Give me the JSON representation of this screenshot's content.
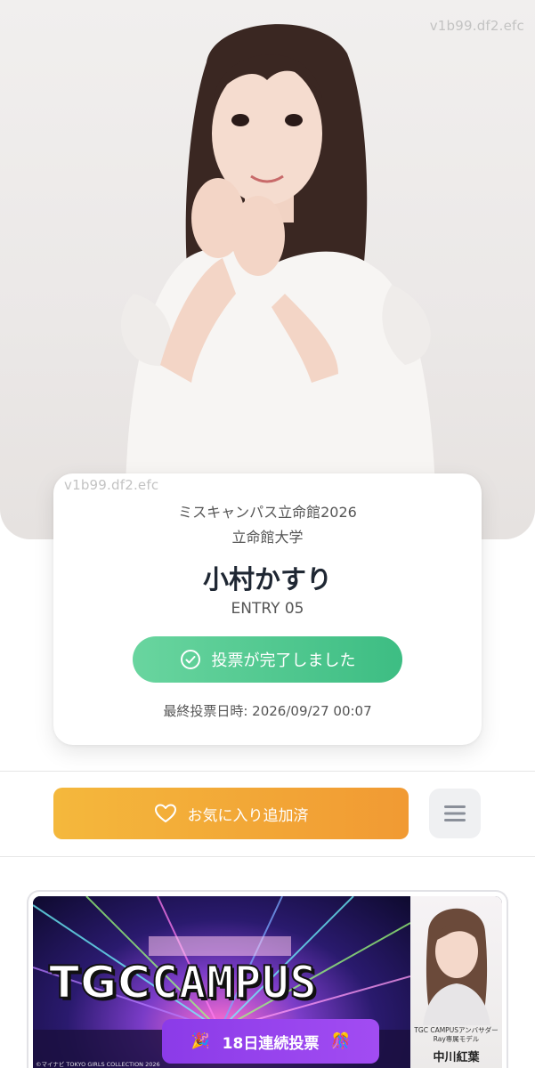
{
  "watermarks": [
    "v1b99.df2.efc",
    "v1b99.df2.efc"
  ],
  "profile": {
    "contest": "ミスキャンパス立命館2026",
    "university": "立命館大学",
    "name": "小村かすり",
    "entry": "ENTRY 05",
    "vote_button": "投票が完了しました",
    "last_vote": "最終投票日時: 2026/09/27 00:07"
  },
  "actions": {
    "favorite_button": "お気に入り追加済"
  },
  "banner": {
    "title_a": "TGC",
    "title_b": "CAMPUS",
    "streak_button": "18日連続投票",
    "copyright": "©マイナビ TOKYO GIRLS COLLECTION 2026",
    "ambassador_caption_1": "TGC CAMPUSアンバサダー",
    "ambassador_caption_2": "Ray専属モデル",
    "ambassador_name": "中川紅葉"
  },
  "colors": {
    "vote_green": "#3dbd83",
    "favorite_orange": "#f19a33",
    "streak_purple": "#9b46ee"
  },
  "icons": {
    "vote": "check-circle-icon",
    "favorite": "heart-icon",
    "menu": "hamburger-menu-icon",
    "party_left": "party-popper-icon",
    "party_right": "confetti-ball-icon"
  }
}
